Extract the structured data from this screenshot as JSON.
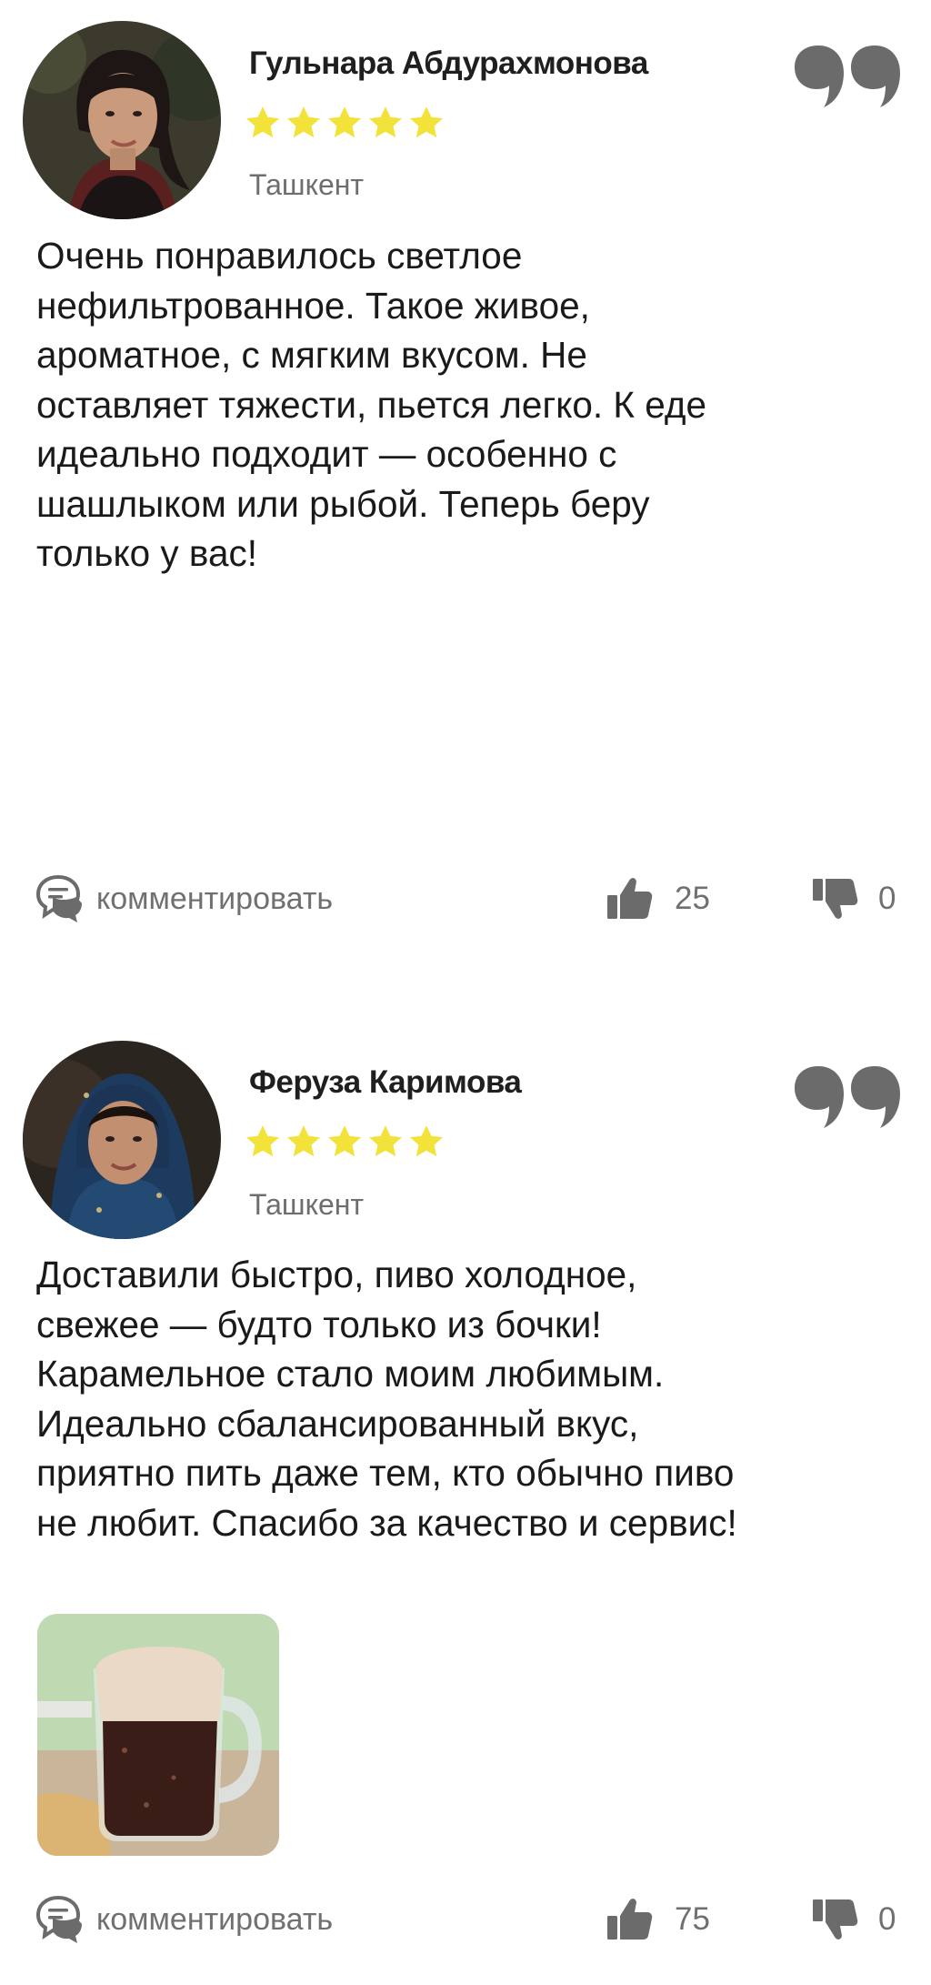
{
  "reviews": [
    {
      "author": "Гульнара Абдурахмонова",
      "rating": 5,
      "city": "Ташкент",
      "text": "Очень понравилось светлое\nнефильтрованное. Такое живое,\nароматное, с мягким вкусом. Не\nоставляет тяжести, пьется легко. К еде\nидеально подходит — особенно с\nшашлыком или рыбой. Теперь беру\nтолько у вас!",
      "comment_label": "комментировать",
      "likes": "25",
      "dislikes": "0"
    },
    {
      "author": "Феруза Каримова",
      "rating": 5,
      "city": "Ташкент",
      "text": "Доставили быстро, пиво холодное,\nсвежее — будто только из бочки!\nКарамельное стало моим любимым.\nИдеально сбалансированный вкус,\nприятно пить даже тем, кто обычно пиво\nне любит. Спасибо за качество и сервис!",
      "comment_label": "комментировать",
      "likes": "75",
      "dislikes": "0"
    }
  ],
  "icons": {
    "quote": "quote-icon",
    "star": "star-icon",
    "comment": "comment-icon",
    "like": "thumbs-up-icon",
    "dislike": "thumbs-down-icon"
  },
  "colors": {
    "star": "#F2E23A",
    "icon_gray": "#6b6b6b",
    "secondary_text": "#6e6e6e",
    "body_text": "#1a1a1a"
  }
}
